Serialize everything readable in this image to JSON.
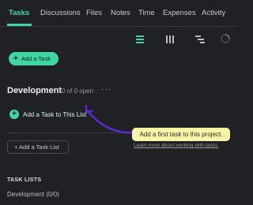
{
  "tabs": [
    {
      "label": "Tasks",
      "active": true
    },
    {
      "label": "Discussions",
      "active": false
    },
    {
      "label": "Files",
      "active": false
    },
    {
      "label": "Notes",
      "active": false
    },
    {
      "label": "Time",
      "active": false
    },
    {
      "label": "Expenses",
      "active": false
    },
    {
      "label": "Activity",
      "active": false
    }
  ],
  "view_icons": [
    "list-view-icon",
    "columns-view-icon",
    "timeline-view-icon",
    "loading-spinner-icon"
  ],
  "toolbar": {
    "add_task_label": "Add a Task"
  },
  "task_list": {
    "name": "Development",
    "count_label": "0 of 0 open",
    "more_label": "···",
    "add_to_list_label": "Add a Task to This List"
  },
  "onboarding": {
    "tooltip_text": "Add a first task to this project.",
    "learn_more_text": "Learn more about working with tasks."
  },
  "add_list_label": "+ Add a Task List",
  "sidebar": {
    "title": "TASK LISTS",
    "items": [
      {
        "label": "Development (0/0)"
      }
    ]
  },
  "colors": {
    "accent": "#3fd6a4",
    "background": "#202124",
    "tooltip": "#f9f5a8",
    "arrow": "#5b2bd1"
  }
}
